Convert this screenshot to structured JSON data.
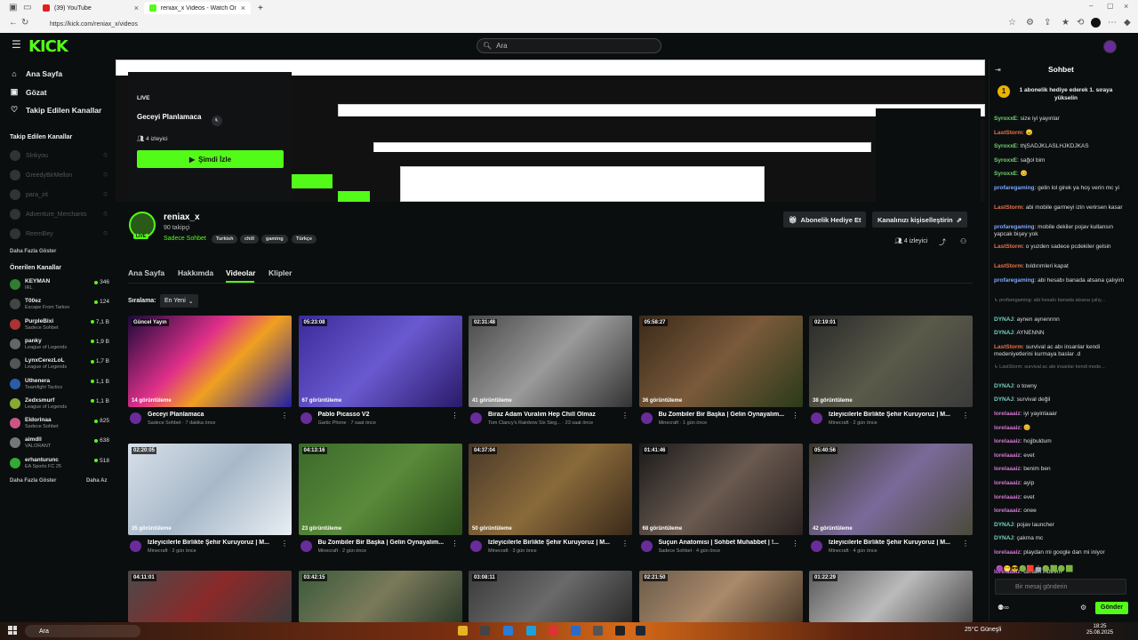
{
  "browser": {
    "tabs": [
      {
        "label": "(39) YouTube",
        "color": "#e02020"
      },
      {
        "label": "reniax_x Videos - Watch On-Dem",
        "color": "#53fc18"
      }
    ],
    "new_tab": "+",
    "url": "https://kick.com/reniax_x/videos"
  },
  "header": {
    "logo": "KICK",
    "search_placeholder": "Ara"
  },
  "sidebar": {
    "nav": [
      {
        "label": "Ana Sayfa",
        "icon": "home-icon"
      },
      {
        "label": "Gözat",
        "icon": "browse-icon"
      },
      {
        "label": "Takip Edilen Kanallar",
        "icon": "heart-icon"
      }
    ],
    "followed_title": "Takip Edilen Kanallar",
    "followed": [
      {
        "name": "Slnkyou"
      },
      {
        "name": "GreedyBirMellon"
      },
      {
        "name": "para_zit"
      },
      {
        "name": "Adventure_Merchants"
      },
      {
        "name": "ReemBey"
      }
    ],
    "show_more": "Daha Fazla Göster",
    "recommended_title": "Önerilen Kanallar",
    "recommended": [
      {
        "name": "KEYMAN",
        "game": "IRL",
        "viewers": "346",
        "color": "#2e7d32"
      },
      {
        "name": "T00ez",
        "game": "Escape From Tarkov",
        "viewers": "124",
        "color": "#444"
      },
      {
        "name": "PurpleBixi",
        "game": "Sadece Sohbet",
        "viewers": "7,1 B",
        "color": "#a33"
      },
      {
        "name": "panky",
        "game": "League of Legends",
        "viewers": "1,9 B",
        "color": "#666"
      },
      {
        "name": "LynxCerezLoL",
        "game": "League of Legends",
        "viewers": "1,7 B",
        "color": "#555"
      },
      {
        "name": "Uthenera",
        "game": "Teamfight Tactics",
        "viewers": "1,1 B",
        "color": "#2b5ca8"
      },
      {
        "name": "Zedxsmurf",
        "game": "League of Legends",
        "viewers": "1,1 B",
        "color": "#8a3"
      },
      {
        "name": "Eldorinaa",
        "game": "Sadece Sohbet",
        "viewers": "825",
        "color": "#c58"
      },
      {
        "name": "aimdll",
        "game": "VALORANT",
        "viewers": "638",
        "color": "#777"
      },
      {
        "name": "erhanturunc",
        "game": "EA Sports FC 25",
        "viewers": "518",
        "color": "#3a3"
      }
    ],
    "show_more2": "Daha Fazla Göster",
    "show_less": "Daha Az"
  },
  "player": {
    "live": "LIVE",
    "title": "Geceyi Planlamaca",
    "viewers": "4 izleyici",
    "watch": "Şimdi İzle"
  },
  "channel": {
    "name": "reniax_x",
    "followers": "90 takipçi",
    "category": "Sadece Sohbet",
    "live": "LIVE",
    "tags": [
      "Turkish",
      "chill",
      "gaming",
      "Türkçe"
    ],
    "gift_btn": "Abonelik Hediye Et",
    "customize_btn": "Kanalınızı kişiselleştirin",
    "viewers": "4 izleyici"
  },
  "tabs": [
    "Ana Sayfa",
    "Hakkımda",
    "Videolar",
    "Klipler"
  ],
  "sort": {
    "label": "Sıralama:",
    "value": "En Yeni"
  },
  "videos": [
    {
      "dur": "Güncel Yayın",
      "views": "14 görüntüleme",
      "title": "Geceyi Planlamaca",
      "sub": "Sadece Sohbet · 7 dakika önce",
      "bg": "linear-gradient(135deg,#1a0a3a,#e0308a 40%,#f0a020 60%,#2020a0)"
    },
    {
      "dur": "05:23:08",
      "views": "67 görüntüleme",
      "title": "Pablo Picasso V2",
      "sub": "Gartic Phone · 7 saat önce",
      "bg": "linear-gradient(135deg,#3a2a9a,#6a5ad0 50%,#2a1a6a)"
    },
    {
      "dur": "02:31:48",
      "views": "41 görüntüleme",
      "title": "Biraz Adam Vuralım Hep Chill Olmaz",
      "sub": "Tom Clancy's Rainbow Six Sieg... · 23 saat önce",
      "bg": "linear-gradient(135deg,#4a4a4a,#9a9a9a 50%,#333)"
    },
    {
      "dur": "05:58:27",
      "views": "36 görüntüleme",
      "title": "Bu Zombiler Bir Başka | Gelin Oynayalım...",
      "sub": "Minecraft · 1 gün önce",
      "bg": "linear-gradient(135deg,#3a2a1a,#7a5a3a 50%,#2a3a1a)"
    },
    {
      "dur": "02:19:01",
      "views": "38 görüntüleme",
      "title": "İzleyicilerle Birlikte Şehir Kuruyoruz | M...",
      "sub": "Minecraft · 2 gün önce",
      "bg": "linear-gradient(135deg,#2a2a2a,#5a5a4a 50%,#3a3a3a)"
    },
    {
      "dur": "02:20:05",
      "views": "35 görüntüleme",
      "title": "İzleyicilerle Birlikte Şehir Kuruyoruz | M...",
      "sub": "Minecraft · 2 gün önce",
      "bg": "linear-gradient(135deg,#d8e0ea,#a8b8c8 50%,#e8eef4)"
    },
    {
      "dur": "04:13:16",
      "views": "23 görüntüleme",
      "title": "Bu Zombiler Bir Başka | Gelin Oynayalım...",
      "sub": "Minecraft · 2 gün önce",
      "bg": "linear-gradient(135deg,#3a6a2a,#5a8a3a 50%,#2a4a1a)"
    },
    {
      "dur": "04:37:04",
      "views": "50 görüntüleme",
      "title": "İzleyicilerle Birlikte Şehir Kuruyoruz | M...",
      "sub": "Minecraft · 3 gün önce",
      "bg": "linear-gradient(135deg,#4a3a2a,#8a6a3a 50%,#3a2a1a)"
    },
    {
      "dur": "01:41:46",
      "views": "68 görüntüleme",
      "title": "Suçun Anatomisi | Sohbet Muhabbet | !...",
      "sub": "Sadece Sohbet · 4 gün önce",
      "bg": "linear-gradient(135deg,#1a1a1a,#6a5a50 50%,#2a2220)"
    },
    {
      "dur": "05:40:56",
      "views": "42 görüntüleme",
      "title": "İzleyicilerle Birlikte Şehir Kuruyoruz | M...",
      "sub": "Minecraft · 4 gün önce",
      "bg": "linear-gradient(135deg,#3a3a2a,#7a6a9a 50%,#4a4a3a)"
    },
    {
      "dur": "04:11:01",
      "views": "",
      "title": "",
      "sub": "",
      "bg": "linear-gradient(135deg,#4a4a4a,#8a2a2a 50%,#3a3a3a)"
    },
    {
      "dur": "03:42:15",
      "views": "",
      "title": "",
      "sub": "",
      "bg": "linear-gradient(135deg,#3a5a3a,#7a7a5a 50%,#2a3a2a)"
    },
    {
      "dur": "03:08:11",
      "views": "",
      "title": "",
      "sub": "",
      "bg": "linear-gradient(135deg,#3a3a3a,#6a6a6a 50%,#2a2a2a)"
    },
    {
      "dur": "02:21:50",
      "views": "",
      "title": "",
      "sub": "",
      "bg": "linear-gradient(135deg,#6a5a4a,#aa8a6a 50%,#4a3a2a)"
    },
    {
      "dur": "01:22:29",
      "views": "",
      "title": "",
      "sub": "",
      "bg": "linear-gradient(135deg,#5a5a5a,#bbb 50%,#4a4a4a)"
    }
  ],
  "chat": {
    "title": "Sohbet",
    "gift_text": "1 abonelik hediye ederek 1. sıraya yükselin",
    "messages": [
      {
        "user": "SyroxxE",
        "text": "size iyi yayınlar",
        "color": "#6fd36f"
      },
      {
        "user": "LastStorm",
        "text": "😠",
        "color": "#e8734a"
      },
      {
        "user": "SyroxxE",
        "text": "thjSADJKLASLHJKDJKAS",
        "color": "#6fd36f"
      },
      {
        "user": "SyroxxE",
        "text": "sağol bim",
        "color": "#6fd36f"
      },
      {
        "user": "SyroxxE",
        "text": "😊",
        "color": "#6fd36f"
      },
      {
        "user": "profaregaming",
        "text": "gelin lol girek ya hoş verin mc yi",
        "color": "#7aa8ff"
      },
      {
        "user": "LastStorm",
        "text": "abi mobile garmeyi izin verirsen kasar",
        "color": "#e8734a"
      },
      {
        "user": "profaregaming",
        "text": "mobile dekiler pojav kullansın yapcak bişey yok",
        "color": "#7aa8ff"
      },
      {
        "user": "LastStorm",
        "text": "o yuzden sadece pcdekiler gelsin",
        "color": "#e8734a"
      },
      {
        "user": "LastStorm",
        "text": "bıldırımleri kapat",
        "color": "#e8734a"
      },
      {
        "user": "profaregaming",
        "text": "abi hesabı banada atsana çalıyim",
        "color": "#7aa8ff"
      },
      {
        "user": "",
        "text": "↳ profaregaming: abi hesabı banada atsana çalıy...",
        "color": "#888"
      },
      {
        "user": "DYNAJ",
        "text": "aynen aynennnn",
        "color": "#6fd3c0"
      },
      {
        "user": "DYNAJ",
        "text": "AYNENNN",
        "color": "#6fd3c0"
      },
      {
        "user": "LastStorm",
        "text": "survival ac abı insanlar kendi medeniyetlerini kurmaya baslar .d",
        "color": "#e8734a"
      },
      {
        "user": "",
        "text": "↳ LastStorm: survival ac abı insanlar kendi mede...",
        "color": "#888"
      },
      {
        "user": "DYNAJ",
        "text": "o towny",
        "color": "#6fd3c0"
      },
      {
        "user": "DYNAJ",
        "text": "survival değil",
        "color": "#6fd3c0"
      },
      {
        "user": "lorelaaaiz",
        "text": "iyi yayinlaaar",
        "color": "#d07ad0"
      },
      {
        "user": "lorelaaaiz",
        "text": "😊",
        "color": "#d07ad0"
      },
      {
        "user": "lorelaaaiz",
        "text": "hojjbuldum",
        "color": "#d07ad0"
      },
      {
        "user": "lorelaaaiz",
        "text": "evet",
        "color": "#d07ad0"
      },
      {
        "user": "lorelaaaiz",
        "text": "benim ben",
        "color": "#d07ad0"
      },
      {
        "user": "lorelaaaiz",
        "text": "ayip",
        "color": "#d07ad0"
      },
      {
        "user": "lorelaaaiz",
        "text": "evet",
        "color": "#d07ad0"
      },
      {
        "user": "lorelaaaiz",
        "text": "onee",
        "color": "#d07ad0"
      },
      {
        "user": "DYNAJ",
        "text": "pojav launcher",
        "color": "#6fd3c0"
      },
      {
        "user": "DYNAJ",
        "text": "çakma mc",
        "color": "#6fd3c0"
      },
      {
        "user": "lorelaaaiz",
        "text": "playdan mi google dan mi iniyor",
        "color": "#d07ad0"
      },
      {
        "user": "lorelaaaiz",
        "text": "tamam indirirm",
        "color": "#d07ad0"
      }
    ],
    "emotes": "🟣😁😎🟢🟥🤖🟢🟩🟢🟩",
    "input_placeholder": "Bir mesaj gönderin",
    "send": "Gönder"
  },
  "taskbar": {
    "search": "Ara",
    "weather": "25°C  Güneşli",
    "time": "18:25",
    "date": "25.08.2025"
  }
}
